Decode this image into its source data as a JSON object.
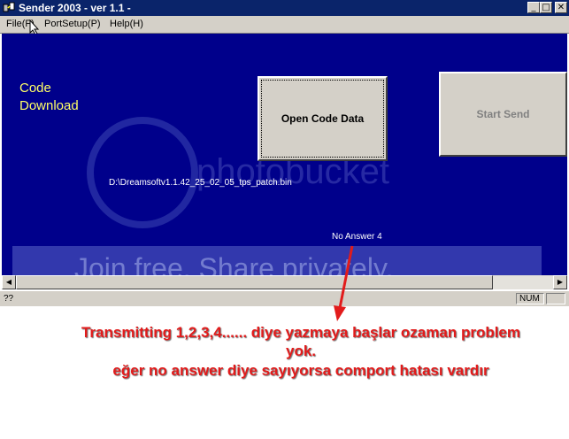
{
  "window": {
    "title": "Sender 2003  - ver 1.1 -",
    "controls": {
      "minimize": "_",
      "maximize": "□",
      "close": "✕"
    }
  },
  "menu": {
    "items": [
      {
        "label": "File(F)"
      },
      {
        "label": "PortSetup(P)"
      },
      {
        "label": "Help(H)"
      }
    ]
  },
  "main": {
    "code_label_line1": "Code",
    "code_label_line2": "Download",
    "open_button": "Open Code Data",
    "start_button": "Start Send",
    "file_path": "D:\\Dreamsoftv1.1.42_25_02_05_tps_patch.bin",
    "no_answer": "No Answer 4"
  },
  "watermark": {
    "brand": "photobucket",
    "tagline": "Join free. Share privately."
  },
  "scrollbar": {
    "left_arrow": "◀",
    "right_arrow": "▶"
  },
  "status": {
    "left": "??",
    "num": "NUM"
  },
  "annotation": {
    "line1": "Transmitting 1,2,3,4...... diye yazmaya başlar ozaman problem",
    "line2": "yok.",
    "line3": "eğer no answer diye sayıyorsa comport hatası vardır"
  },
  "colors": {
    "titlebar": "#0a246a",
    "client_bg": "#00008b",
    "label_yellow": "#ffff66",
    "annotation_red": "#e21b1b"
  }
}
